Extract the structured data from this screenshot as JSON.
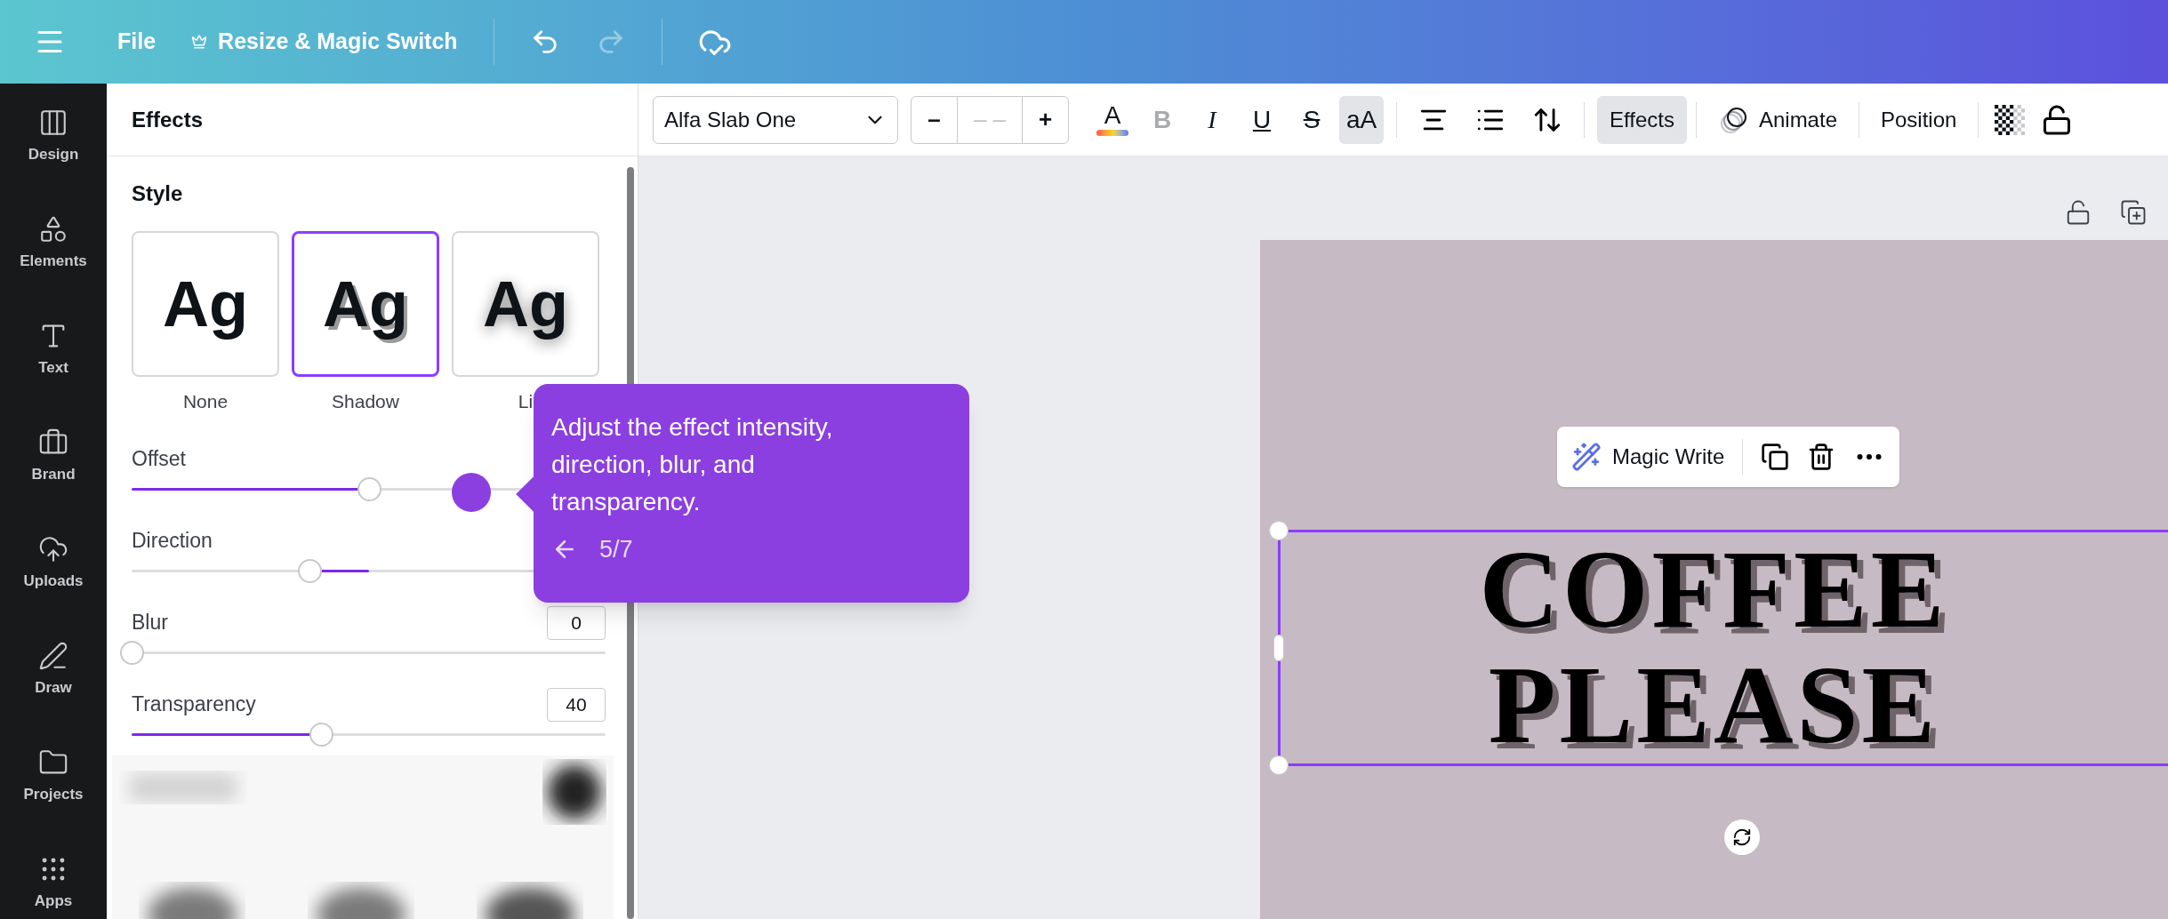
{
  "top_bar": {
    "menu": "File",
    "resize_button": "Resize & Magic Switch"
  },
  "rail": [
    {
      "label": "Design",
      "kind": "design"
    },
    {
      "label": "Elements",
      "kind": "elements"
    },
    {
      "label": "Text",
      "kind": "text"
    },
    {
      "label": "Brand",
      "kind": "brand"
    },
    {
      "label": "Uploads",
      "kind": "uploads"
    },
    {
      "label": "Draw",
      "kind": "draw"
    },
    {
      "label": "Projects",
      "kind": "projects"
    },
    {
      "label": "Apps",
      "kind": "apps"
    }
  ],
  "panel": {
    "title": "Effects",
    "section": "Style",
    "styles": [
      {
        "label": "None",
        "sample": "Ag",
        "kind": "none",
        "selected": false
      },
      {
        "label": "Shadow",
        "sample": "Ag",
        "kind": "shadow",
        "selected": true
      },
      {
        "label": "Li",
        "sample": "Ag",
        "kind": "lift",
        "selected": false
      }
    ],
    "sliders": [
      {
        "label": "Offset",
        "kind": "left",
        "level": 0.5
      },
      {
        "label": "Direction",
        "kind": "center",
        "level": 0.375
      },
      {
        "label": "Blur",
        "kind": "left",
        "value": "0",
        "level": 0
      },
      {
        "label": "Transparency",
        "kind": "left",
        "value": "40",
        "level": 0.4
      }
    ]
  },
  "toolbar": {
    "font": "Alfa Slab One",
    "size": "– –",
    "decrease": "–",
    "increase": "+",
    "format": [
      {
        "label": "A",
        "kind": "color",
        "disabled": false,
        "selected": false
      },
      {
        "label": "B",
        "kind": "bold",
        "disabled": true,
        "selected": false
      },
      {
        "label": "I",
        "kind": "italic",
        "disabled": false,
        "selected": false
      },
      {
        "label": "U",
        "kind": "underline",
        "disabled": false,
        "selected": false
      },
      {
        "label": "S",
        "kind": "strike",
        "disabled": false,
        "selected": false
      },
      {
        "label": "aA",
        "kind": "case",
        "disabled": false,
        "selected": true
      }
    ],
    "buttons": [
      {
        "label": "Effects",
        "kind": "plain",
        "selected": true
      },
      {
        "label": "Animate",
        "kind": "animate",
        "selected": false
      },
      {
        "label": "Position",
        "kind": "plain",
        "selected": false
      }
    ]
  },
  "canvas": {
    "lines": [
      "COFFEE",
      "PLEASE"
    ],
    "magic_write": "Magic Write"
  },
  "tooltip": {
    "text": "Adjust the effect intensity, direction, blur, and transparency.",
    "step": "5/7"
  }
}
